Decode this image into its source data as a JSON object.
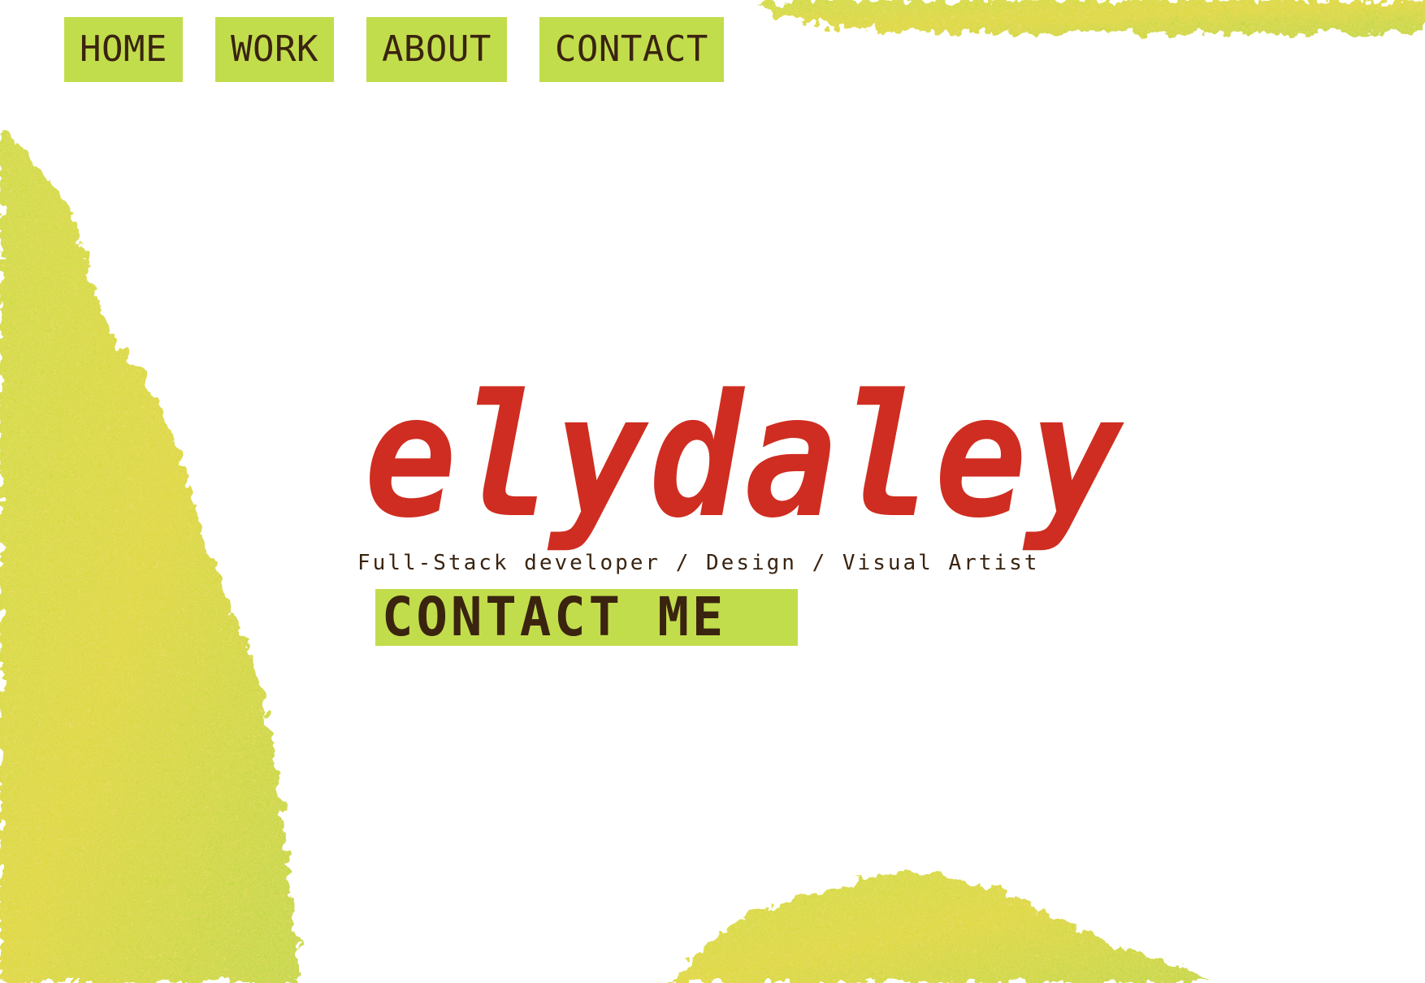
{
  "nav": {
    "items": [
      {
        "label": "HOME"
      },
      {
        "label": "WORK"
      },
      {
        "label": "ABOUT"
      },
      {
        "label": "CONTACT"
      }
    ]
  },
  "hero": {
    "title": "elydaley",
    "tagline": "Full-Stack developer / Design / Visual Artist",
    "cta_label": "CONTACT ME"
  },
  "colors": {
    "accent_green": "#c2dd4c",
    "title_red": "#cf2d21",
    "text_brown": "#3a2410",
    "background": "#ffffff",
    "texture_yellow": "#e8d43a",
    "texture_orange": "#e0a23a"
  }
}
